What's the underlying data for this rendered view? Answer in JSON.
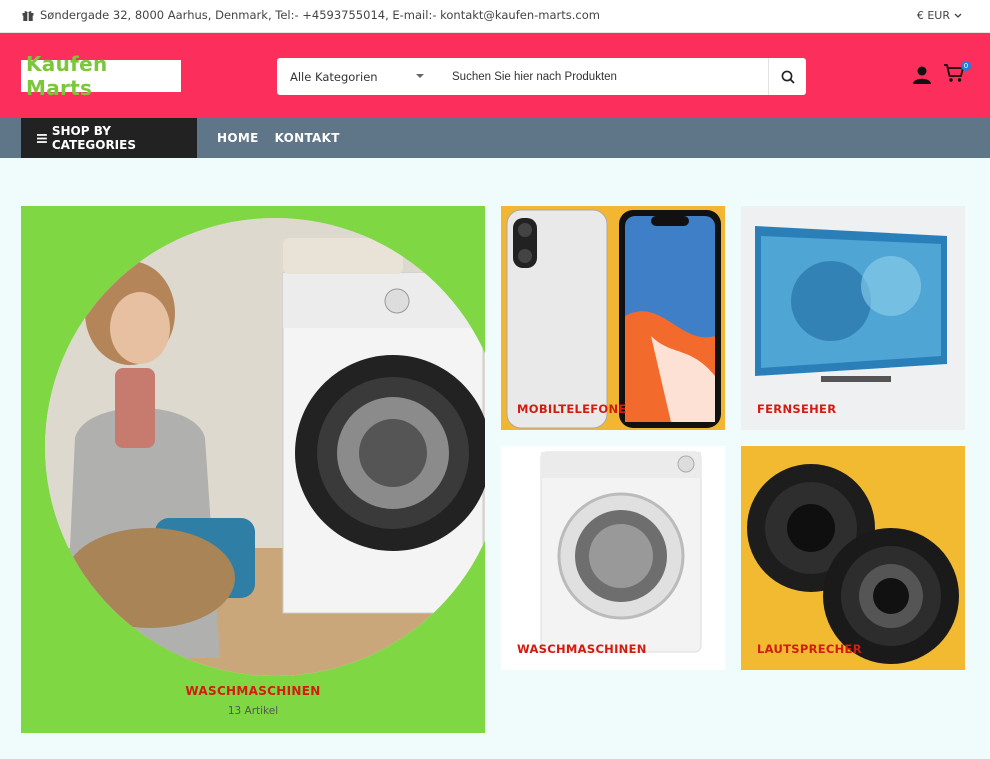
{
  "topbar": {
    "address": "Søndergade 32, 8000 Aarhus, Denmark, Tel:- +4593755014, E-mail:- kontakt@kaufen-marts.com",
    "currency": "€ EUR"
  },
  "header": {
    "logo": "Kaufen Marts",
    "category_select": "Alle Kategorien",
    "search_placeholder": "Suchen Sie hier nach Produkten",
    "cart_count": "0"
  },
  "nav": {
    "shop_by_categories": "SHOP BY CATEGORIES",
    "items": [
      "HOME",
      "KONTAKT"
    ]
  },
  "banners": {
    "main": {
      "title": "WASCHMASCHINEN",
      "count": "13 Artikel"
    },
    "tiles": [
      "MOBILTELEFONE",
      "FERNSEHER",
      "WASCHMASCHINEN",
      "LAUTSPRECHER"
    ]
  },
  "colors": {
    "header_bg": "#fb2e5c",
    "nav_bg": "#5f7588",
    "logo_text": "#7bc63a",
    "banner_green": "#7fd843",
    "label_red": "#d21c10"
  }
}
